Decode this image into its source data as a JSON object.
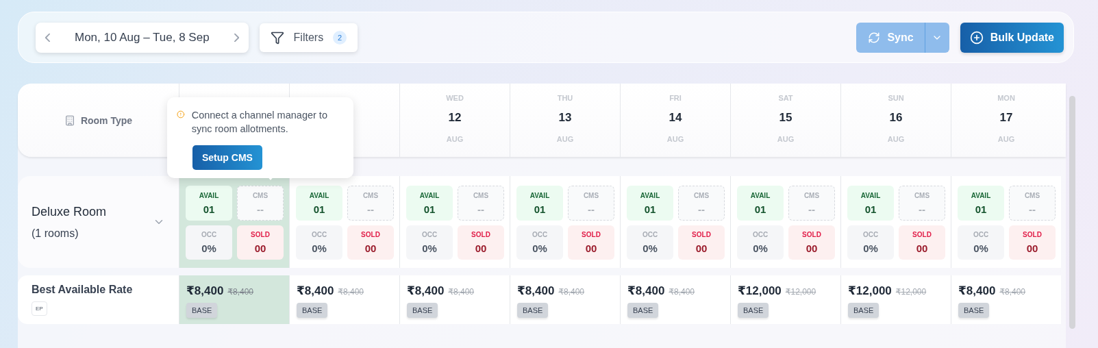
{
  "toolbar": {
    "date_range": "Mon, 10 Aug – Tue, 8 Sep",
    "filters": {
      "label": "Filters",
      "count": "2"
    },
    "sync": {
      "label": "Sync",
      "disabled": true
    },
    "bulk_update": "Bulk Update"
  },
  "table": {
    "room_type_header": "Room Type",
    "days": [
      {
        "selected": true
      },
      {
        "selected": false
      },
      {
        "weekday": "WED",
        "date": "12",
        "month": "AUG",
        "selected": false
      },
      {
        "weekday": "THU",
        "date": "13",
        "month": "AUG",
        "selected": false
      },
      {
        "weekday": "FRI",
        "date": "14",
        "month": "AUG",
        "selected": false
      },
      {
        "weekday": "SAT",
        "date": "15",
        "month": "AUG",
        "selected": false
      },
      {
        "weekday": "SUN",
        "date": "16",
        "month": "AUG",
        "selected": false
      },
      {
        "weekday": "MON",
        "date": "17",
        "month": "AUG",
        "selected": false
      }
    ],
    "room": {
      "name": "Deluxe Room",
      "count": "(1 rooms)"
    },
    "room_cells": [
      [
        {
          "kind": "avail",
          "label": "AVAIL",
          "value": "01"
        },
        {
          "kind": "cms",
          "label": "CMS",
          "value": "--"
        },
        {
          "kind": "occ",
          "label": "OCC",
          "value": "0%"
        },
        {
          "kind": "sold",
          "label": "SOLD",
          "value": "00"
        }
      ],
      [
        {
          "kind": "avail",
          "label": "AVAIL",
          "value": "01"
        },
        {
          "kind": "cms",
          "label": "CMS",
          "value": "--"
        },
        {
          "kind": "occ",
          "label": "OCC",
          "value": "0%"
        },
        {
          "kind": "sold",
          "label": "SOLD",
          "value": "00"
        }
      ],
      [
        {
          "kind": "avail",
          "label": "AVAIL",
          "value": "01"
        },
        {
          "kind": "cms",
          "label": "CMS",
          "value": "--"
        },
        {
          "kind": "occ",
          "label": "OCC",
          "value": "0%"
        },
        {
          "kind": "sold",
          "label": "SOLD",
          "value": "00"
        }
      ],
      [
        {
          "kind": "avail",
          "label": "AVAIL",
          "value": "01"
        },
        {
          "kind": "cms",
          "label": "CMS",
          "value": "--"
        },
        {
          "kind": "occ",
          "label": "OCC",
          "value": "0%"
        },
        {
          "kind": "sold",
          "label": "SOLD",
          "value": "00"
        }
      ],
      [
        {
          "kind": "avail",
          "label": "AVAIL",
          "value": "01"
        },
        {
          "kind": "cms",
          "label": "CMS",
          "value": "--"
        },
        {
          "kind": "occ",
          "label": "OCC",
          "value": "0%"
        },
        {
          "kind": "sold",
          "label": "SOLD",
          "value": "00"
        }
      ],
      [
        {
          "kind": "avail",
          "label": "AVAIL",
          "value": "01"
        },
        {
          "kind": "cms",
          "label": "CMS",
          "value": "--"
        },
        {
          "kind": "occ",
          "label": "OCC",
          "value": "0%"
        },
        {
          "kind": "sold",
          "label": "SOLD",
          "value": "00"
        }
      ],
      [
        {
          "kind": "avail",
          "label": "AVAIL",
          "value": "01"
        },
        {
          "kind": "cms",
          "label": "CMS",
          "value": "--"
        },
        {
          "kind": "occ",
          "label": "OCC",
          "value": "0%"
        },
        {
          "kind": "sold",
          "label": "SOLD",
          "value": "00"
        }
      ],
      [
        {
          "kind": "avail",
          "label": "AVAIL",
          "value": "01"
        },
        {
          "kind": "cms",
          "label": "CMS",
          "value": "--"
        },
        {
          "kind": "occ",
          "label": "OCC",
          "value": "0%"
        },
        {
          "kind": "sold",
          "label": "SOLD",
          "value": "00"
        }
      ]
    ],
    "rate": {
      "name": "Best Available Rate",
      "plan": "EP"
    },
    "rate_cells": [
      {
        "price": "₹8,400",
        "original": "₹8,400",
        "tag": "BASE"
      },
      {
        "price": "₹8,400",
        "original": "₹8,400",
        "tag": "BASE"
      },
      {
        "price": "₹8,400",
        "original": "₹8,400",
        "tag": "BASE"
      },
      {
        "price": "₹8,400",
        "original": "₹8,400",
        "tag": "BASE"
      },
      {
        "price": "₹8,400",
        "original": "₹8,400",
        "tag": "BASE"
      },
      {
        "price": "₹12,000",
        "original": "₹12,000",
        "tag": "BASE"
      },
      {
        "price": "₹12,000",
        "original": "₹12,000",
        "tag": "BASE"
      },
      {
        "price": "₹8,400",
        "original": "₹8,400",
        "tag": "BASE"
      }
    ]
  },
  "popover": {
    "message": "Connect a channel manager to sync room allotments.",
    "button": "Setup CMS"
  }
}
